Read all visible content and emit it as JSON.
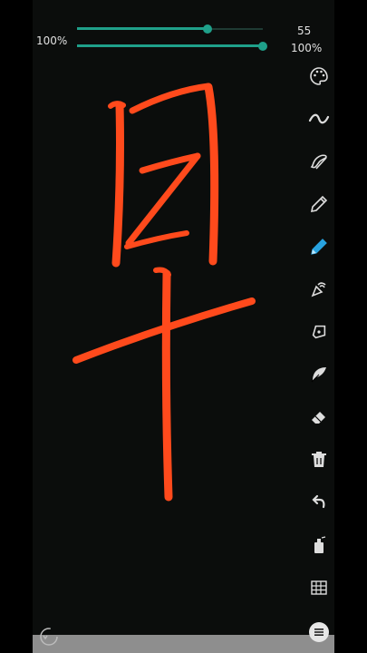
{
  "sliders": {
    "size": {
      "value": 55,
      "value_label": "55"
    },
    "opacity": {
      "value": 100,
      "left_label": "100%",
      "right_label": "100%"
    }
  },
  "colors": {
    "stroke": "#ff4a1c",
    "accent": "#1fa08a",
    "canvas": "#0b0d0c"
  },
  "toolbar": {
    "items": [
      {
        "icon": "palette-icon",
        "name": "palette-tool",
        "active": false
      },
      {
        "icon": "wave-stroke-icon",
        "name": "stroke-style-tool",
        "active": false
      },
      {
        "icon": "brush-palette-icon",
        "name": "brush-settings-tool",
        "active": false
      },
      {
        "icon": "pencil-icon",
        "name": "pencil-tool",
        "active": false
      },
      {
        "icon": "pencil-icon",
        "name": "pencil-blue-tool",
        "active": true
      },
      {
        "icon": "calligraphy-pen-icon",
        "name": "calligraphy-pen-tool",
        "active": false
      },
      {
        "icon": "fountain-pen-icon",
        "name": "fountain-pen-tool",
        "active": false
      },
      {
        "icon": "feather-icon",
        "name": "feather-brush-tool",
        "active": false
      },
      {
        "icon": "eraser-icon",
        "name": "eraser-tool",
        "active": false
      },
      {
        "icon": "trash-icon",
        "name": "clear-canvas-tool",
        "active": false
      },
      {
        "icon": "undo-icon",
        "name": "undo-tool",
        "active": false
      },
      {
        "icon": "spray-can-icon",
        "name": "spray-tool",
        "active": false
      },
      {
        "icon": "grid-icon",
        "name": "grid-tool",
        "active": false
      }
    ]
  },
  "menu": {
    "icon": "menu-icon"
  },
  "spinner": {
    "icon": "refresh-icon"
  }
}
